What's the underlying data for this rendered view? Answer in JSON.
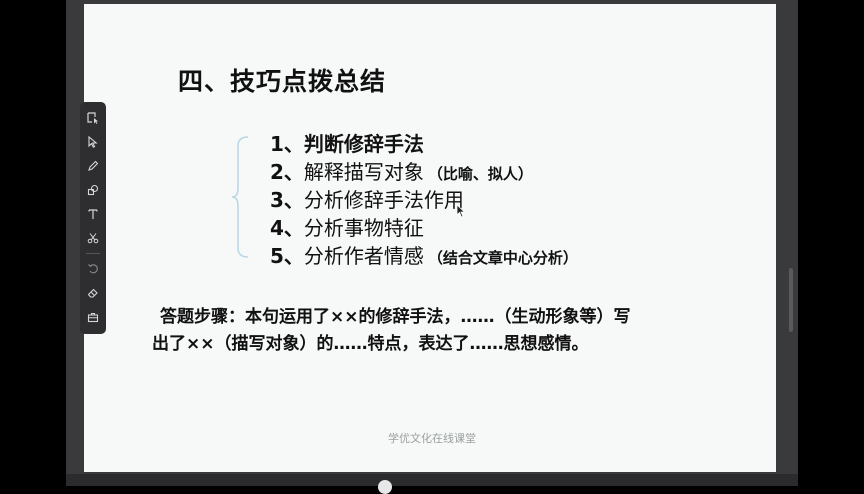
{
  "slide": {
    "title": "四、技巧点拨总结",
    "steps": [
      {
        "num": "1、",
        "text": "判断修辞手法",
        "note": ""
      },
      {
        "num": "2、",
        "text": "解释描写对象",
        "note": "（比喻、拟人）"
      },
      {
        "num": "3、",
        "text": "分析修辞手法作用",
        "note": ""
      },
      {
        "num": "4、",
        "text": "分析事物特征",
        "note": ""
      },
      {
        "num": "5、",
        "text": "分析作者情感",
        "note": "（结合文章中心分析）"
      }
    ],
    "answer_line1": "答题步骤：本句运用了××的修辞手法，……（生动形象等）写",
    "answer_line2": "出了××（描写对象）的……特点，表达了……思想感情。",
    "watermark": "学优文化在线课堂"
  },
  "toolbar": {
    "tools": [
      "select-area-icon",
      "pointer-icon",
      "pen-icon",
      "shapes-icon",
      "text-icon",
      "scissors-icon",
      "undo-icon",
      "eraser-icon",
      "toolbox-icon"
    ]
  },
  "colors": {
    "slide_bg": "#f7f9f8",
    "frame_bg": "#3a3a3c",
    "toolbar_bg": "#2e2e30",
    "brace": "#b8d6e6"
  }
}
